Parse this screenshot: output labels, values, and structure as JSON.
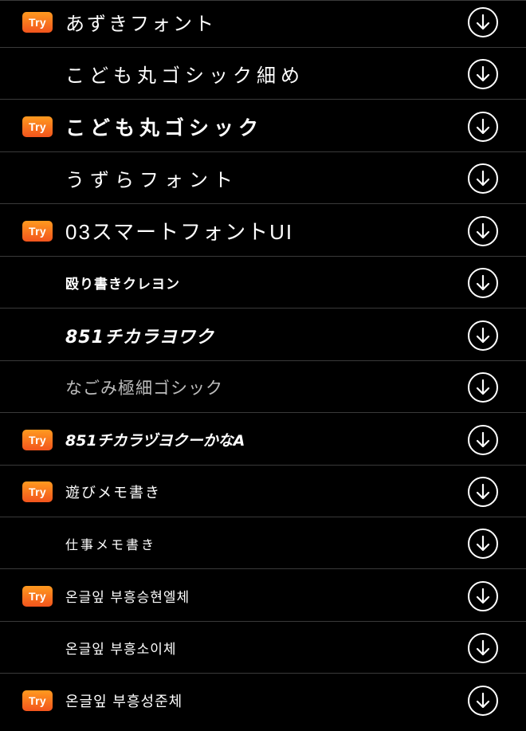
{
  "try_label": "Try",
  "fonts": [
    {
      "name": "あずきフォント",
      "try": true
    },
    {
      "name": "こども丸ゴシック細め",
      "try": false
    },
    {
      "name": "こども丸ゴシック",
      "try": true
    },
    {
      "name": "うずらフォント",
      "try": false
    },
    {
      "name": "03スマートフォントUI",
      "try": true
    },
    {
      "name": "殴り書きクレヨン",
      "try": false
    },
    {
      "name": "851チカラヨワク",
      "try": false
    },
    {
      "name": "なごみ極細ゴシック",
      "try": false
    },
    {
      "name": "851チカラヅヨクーかなA",
      "try": true
    },
    {
      "name": "遊びメモ書き",
      "try": true
    },
    {
      "name": "仕事メモ書き",
      "try": false
    },
    {
      "name": "온글잎 부흥승현엘체",
      "try": true
    },
    {
      "name": "온글잎 부흥소이체",
      "try": false
    },
    {
      "name": "온글잎 부흥성준체",
      "try": true
    }
  ],
  "icons": {
    "try_badge": "try-badge",
    "download": "download-arrow-icon"
  },
  "colors": {
    "background": "#000000",
    "divider": "#3a3a3a",
    "try_gradient_top": "#ff9a1f",
    "try_gradient_bottom": "#f2541d",
    "text": "#ffffff"
  }
}
